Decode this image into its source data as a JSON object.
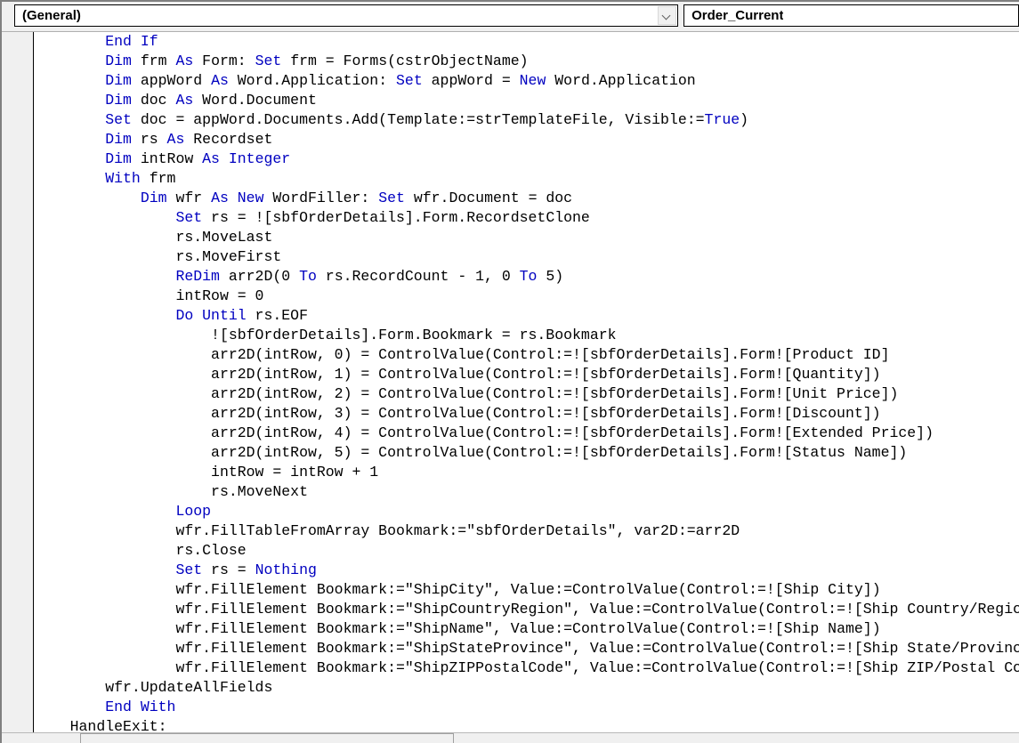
{
  "window": {
    "kind": "vba-code-editor",
    "accent_keyword_color": "#0000C0",
    "text_color": "#000000",
    "background_color": "#FFFFFF",
    "margin_color": "#F0F0F0"
  },
  "combo_bar": {
    "object_combo": {
      "value": "(General)",
      "arrow_icon": "chevron-down-icon"
    },
    "procedure_combo": {
      "value": "Order_Current",
      "arrow_icon": "chevron-down-icon"
    }
  },
  "code": {
    "language": "VBA",
    "lines": [
      {
        "indent": 8,
        "tokens": [
          {
            "t": "End If",
            "c": "kw"
          }
        ]
      },
      {
        "indent": 8,
        "tokens": [
          {
            "t": "Dim",
            "c": "kw"
          },
          {
            "t": " frm ",
            "c": "id"
          },
          {
            "t": "As",
            "c": "kw"
          },
          {
            "t": " Form: ",
            "c": "id"
          },
          {
            "t": "Set",
            "c": "kw"
          },
          {
            "t": " frm = Forms(cstrObjectName)",
            "c": "id"
          }
        ]
      },
      {
        "indent": 8,
        "tokens": [
          {
            "t": "Dim",
            "c": "kw"
          },
          {
            "t": " appWord ",
            "c": "id"
          },
          {
            "t": "As",
            "c": "kw"
          },
          {
            "t": " Word.Application: ",
            "c": "id"
          },
          {
            "t": "Set",
            "c": "kw"
          },
          {
            "t": " appWord = ",
            "c": "id"
          },
          {
            "t": "New",
            "c": "kw"
          },
          {
            "t": " Word.Application",
            "c": "id"
          }
        ]
      },
      {
        "indent": 8,
        "tokens": [
          {
            "t": "Dim",
            "c": "kw"
          },
          {
            "t": " doc ",
            "c": "id"
          },
          {
            "t": "As",
            "c": "kw"
          },
          {
            "t": " Word.Document",
            "c": "id"
          }
        ]
      },
      {
        "indent": 8,
        "tokens": [
          {
            "t": "Set",
            "c": "kw"
          },
          {
            "t": " doc = appWord.Documents.Add(Template:=strTemplateFile, Visible:=",
            "c": "id"
          },
          {
            "t": "True",
            "c": "kw"
          },
          {
            "t": ")",
            "c": "id"
          }
        ]
      },
      {
        "indent": 8,
        "tokens": [
          {
            "t": "Dim",
            "c": "kw"
          },
          {
            "t": " rs ",
            "c": "id"
          },
          {
            "t": "As",
            "c": "kw"
          },
          {
            "t": " Recordset",
            "c": "id"
          }
        ]
      },
      {
        "indent": 8,
        "tokens": [
          {
            "t": "Dim",
            "c": "kw"
          },
          {
            "t": " intRow ",
            "c": "id"
          },
          {
            "t": "As",
            "c": "kw"
          },
          {
            "t": " ",
            "c": "id"
          },
          {
            "t": "Integer",
            "c": "kw"
          }
        ]
      },
      {
        "indent": 8,
        "tokens": [
          {
            "t": "With",
            "c": "kw"
          },
          {
            "t": " frm",
            "c": "id"
          }
        ]
      },
      {
        "indent": 12,
        "tokens": [
          {
            "t": "Dim",
            "c": "kw"
          },
          {
            "t": " wfr ",
            "c": "id"
          },
          {
            "t": "As",
            "c": "kw"
          },
          {
            "t": " ",
            "c": "id"
          },
          {
            "t": "New",
            "c": "kw"
          },
          {
            "t": " WordFiller: ",
            "c": "id"
          },
          {
            "t": "Set",
            "c": "kw"
          },
          {
            "t": " wfr.Document = doc",
            "c": "id"
          }
        ]
      },
      {
        "indent": 16,
        "tokens": [
          {
            "t": "Set",
            "c": "kw"
          },
          {
            "t": " rs = ![sbfOrderDetails].Form.RecordsetClone",
            "c": "id"
          }
        ]
      },
      {
        "indent": 16,
        "tokens": [
          {
            "t": "rs.MoveLast",
            "c": "id"
          }
        ]
      },
      {
        "indent": 16,
        "tokens": [
          {
            "t": "rs.MoveFirst",
            "c": "id"
          }
        ]
      },
      {
        "indent": 16,
        "tokens": [
          {
            "t": "ReDim",
            "c": "kw"
          },
          {
            "t": " arr2D(0 ",
            "c": "id"
          },
          {
            "t": "To",
            "c": "kw"
          },
          {
            "t": " rs.RecordCount - 1, 0 ",
            "c": "id"
          },
          {
            "t": "To",
            "c": "kw"
          },
          {
            "t": " 5)",
            "c": "id"
          }
        ]
      },
      {
        "indent": 16,
        "tokens": [
          {
            "t": "intRow = 0",
            "c": "id"
          }
        ]
      },
      {
        "indent": 16,
        "tokens": [
          {
            "t": "Do Until",
            "c": "kw"
          },
          {
            "t": " rs.EOF",
            "c": "id"
          }
        ]
      },
      {
        "indent": 20,
        "tokens": [
          {
            "t": "![sbfOrderDetails].Form.Bookmark = rs.Bookmark",
            "c": "id"
          }
        ]
      },
      {
        "indent": 20,
        "tokens": [
          {
            "t": "arr2D(intRow, 0) = ControlValue(Control:=![sbfOrderDetails].Form![Product ID]",
            "c": "id"
          }
        ]
      },
      {
        "indent": 20,
        "tokens": [
          {
            "t": "arr2D(intRow, 1) = ControlValue(Control:=![sbfOrderDetails].Form![Quantity])",
            "c": "id"
          }
        ]
      },
      {
        "indent": 20,
        "tokens": [
          {
            "t": "arr2D(intRow, 2) = ControlValue(Control:=![sbfOrderDetails].Form![Unit Price])",
            "c": "id"
          }
        ]
      },
      {
        "indent": 20,
        "tokens": [
          {
            "t": "arr2D(intRow, 3) = ControlValue(Control:=![sbfOrderDetails].Form![Discount])",
            "c": "id"
          }
        ]
      },
      {
        "indent": 20,
        "tokens": [
          {
            "t": "arr2D(intRow, 4) = ControlValue(Control:=![sbfOrderDetails].Form![Extended Price])",
            "c": "id"
          }
        ]
      },
      {
        "indent": 20,
        "tokens": [
          {
            "t": "arr2D(intRow, 5) = ControlValue(Control:=![sbfOrderDetails].Form![Status Name])",
            "c": "id"
          }
        ]
      },
      {
        "indent": 20,
        "tokens": [
          {
            "t": "intRow = intRow + 1",
            "c": "id"
          }
        ]
      },
      {
        "indent": 20,
        "tokens": [
          {
            "t": "rs.MoveNext",
            "c": "id"
          }
        ]
      },
      {
        "indent": 16,
        "tokens": [
          {
            "t": "Loop",
            "c": "kw"
          }
        ]
      },
      {
        "indent": 16,
        "tokens": [
          {
            "t": "wfr.FillTableFromArray Bookmark:=",
            "c": "id"
          },
          {
            "t": "\"sbfOrderDetails\"",
            "c": "str"
          },
          {
            "t": ", var2D:=arr2D",
            "c": "id"
          }
        ]
      },
      {
        "indent": 16,
        "tokens": [
          {
            "t": "rs.Close",
            "c": "id"
          }
        ]
      },
      {
        "indent": 16,
        "tokens": [
          {
            "t": "Set",
            "c": "kw"
          },
          {
            "t": " rs = ",
            "c": "id"
          },
          {
            "t": "Nothing",
            "c": "kw"
          }
        ]
      },
      {
        "indent": 16,
        "tokens": [
          {
            "t": "wfr.FillElement Bookmark:=",
            "c": "id"
          },
          {
            "t": "\"ShipCity\"",
            "c": "str"
          },
          {
            "t": ", Value:=ControlValue(Control:=![Ship City])",
            "c": "id"
          }
        ]
      },
      {
        "indent": 16,
        "tokens": [
          {
            "t": "wfr.FillElement Bookmark:=",
            "c": "id"
          },
          {
            "t": "\"ShipCountryRegion\"",
            "c": "str"
          },
          {
            "t": ", Value:=ControlValue(Control:=![Ship Country/Region])",
            "c": "id"
          }
        ]
      },
      {
        "indent": 16,
        "tokens": [
          {
            "t": "wfr.FillElement Bookmark:=",
            "c": "id"
          },
          {
            "t": "\"ShipName\"",
            "c": "str"
          },
          {
            "t": ", Value:=ControlValue(Control:=![Ship Name])",
            "c": "id"
          }
        ]
      },
      {
        "indent": 16,
        "tokens": [
          {
            "t": "wfr.FillElement Bookmark:=",
            "c": "id"
          },
          {
            "t": "\"ShipStateProvince\"",
            "c": "str"
          },
          {
            "t": ", Value:=ControlValue(Control:=![Ship State/Province])",
            "c": "id"
          }
        ]
      },
      {
        "indent": 16,
        "tokens": [
          {
            "t": "wfr.FillElement Bookmark:=",
            "c": "id"
          },
          {
            "t": "\"ShipZIPPostalCode\"",
            "c": "str"
          },
          {
            "t": ", Value:=ControlValue(Control:=![Ship ZIP/Postal Code])",
            "c": "id"
          }
        ]
      },
      {
        "indent": 8,
        "tokens": [
          {
            "t": "wfr.UpdateAllFields",
            "c": "id"
          }
        ]
      },
      {
        "indent": 8,
        "tokens": [
          {
            "t": "End With",
            "c": "kw"
          }
        ]
      },
      {
        "indent": 4,
        "tokens": [
          {
            "t": "HandleExit:",
            "c": "id"
          }
        ]
      }
    ]
  },
  "scrollbar": {
    "orientation": "horizontal",
    "thumb_label": "horizontal-scroll-thumb"
  }
}
